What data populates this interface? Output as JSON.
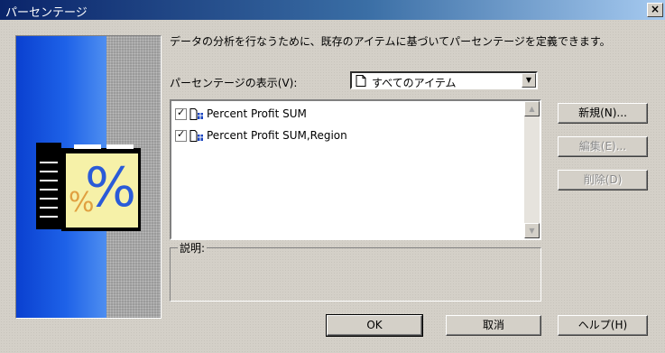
{
  "window": {
    "title": "パーセンテージ"
  },
  "dialog": {
    "description": "データの分析を行なうために、既存のアイテムに基づいてパーセンテージを定義できます。",
    "show_label": "パーセンテージの表示(V):",
    "show_combo": {
      "value": "すべてのアイテム"
    },
    "items": [
      {
        "label": "Percent Profit SUM",
        "checked": true
      },
      {
        "label": "Percent Profit SUM,Region",
        "checked": true
      }
    ],
    "description_group_label": "説明:"
  },
  "buttons": {
    "new": "新規(N)...",
    "edit": "編集(E)...",
    "delete": "削除(D)",
    "ok": "OK",
    "cancel": "取消",
    "help": "ヘルプ(H)"
  },
  "side_panel": {
    "image_text": "%"
  },
  "colors": {
    "title_start": "#0a246a",
    "title_end": "#a6caf0",
    "face": "#d4d0c8"
  }
}
